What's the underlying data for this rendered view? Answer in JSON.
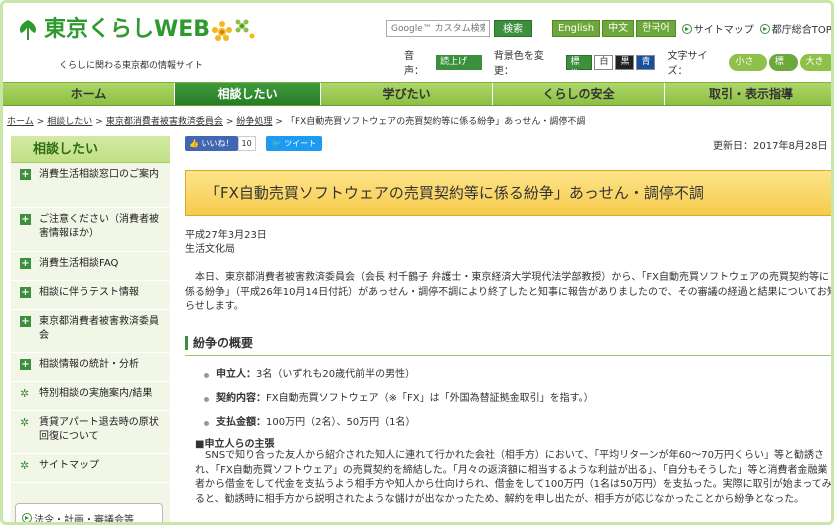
{
  "header": {
    "logo_text": "東京くらしWEB",
    "tagline": "くらしに関わる東京都の情報サイト",
    "search_placeholder": "Google™ カスタム検索",
    "search_button": "検索",
    "languages": [
      "English",
      "中文",
      "한국어"
    ],
    "sitemap_link": "サイトマップ",
    "tokyo_top_link": "都庁総合TOP",
    "voice_label": "音声：",
    "read_aloud": "読上げ",
    "bgcolor_label": "背景色を変更：",
    "bg_options": [
      "標準",
      "白",
      "黒",
      "青"
    ],
    "fontsize_label": "文字サイズ：",
    "fontsize_options": [
      "小さく",
      "標準",
      "大きく"
    ]
  },
  "nav": {
    "items": [
      {
        "label": "ホーム",
        "active": false
      },
      {
        "label": "相談したい",
        "active": true
      },
      {
        "label": "学びたい",
        "active": false
      },
      {
        "label": "くらしの安全",
        "active": false
      },
      {
        "label": "取引・表示指導",
        "active": false
      }
    ]
  },
  "breadcrumb": {
    "items": [
      "ホーム",
      "相談したい",
      "東京都消費者被害救済委員会",
      "紛争処理"
    ],
    "current": "「FX自動売買ソフトウェアの売買契約等に係る紛争」あっせん・調停不調"
  },
  "sidebar": {
    "title": "相談したい",
    "items": [
      {
        "label": "消費生活相談窓口のご案内",
        "icon": "plus-icon"
      },
      {
        "label": "ご注意ください（消費者被害情報ほか）",
        "icon": "plus-icon"
      },
      {
        "label": "消費生活相談FAQ",
        "icon": "plus-icon"
      },
      {
        "label": "相談に伴うテスト情報",
        "icon": "plus-icon"
      },
      {
        "label": "東京都消費者被害救済委員会",
        "icon": "plus-icon"
      },
      {
        "label": "相談情報の統計・分析",
        "icon": "plus-icon"
      },
      {
        "label": "特別相談の実施案内/結果",
        "icon": "star-icon"
      },
      {
        "label": "賃貸アパート退去時の原状回復について",
        "icon": "star-icon"
      },
      {
        "label": "サイトマップ",
        "icon": "star-icon"
      }
    ],
    "bottom_link": "法令・計画・審議会等"
  },
  "share": {
    "like_label": "いいね！",
    "like_count": "10",
    "tweet_label": "ツイート"
  },
  "main": {
    "updated": "更新日：2017年8月28日",
    "title": "「FX自動売買ソフトウェアの売買契約等に係る紛争」あっせん・調停不調",
    "date": "平成27年3月23日",
    "org": "生活文化局",
    "intro": "本日、東京都消費者被害救済委員会（会長 村千鶴子 弁護士・東京経済大学現代法学部教授）から、「FX自動売買ソフトウェアの売買契約等に係る紛争」（平成26年10月14日付託）があっせん・調停不調により終了したと知事に報告がありましたので、その審議の経過と結果についてお知らせします。",
    "section_title": "紛争の概要",
    "bullets": [
      {
        "label": "申立人：",
        "text": "3名（いずれも20歳代前半の男性）"
      },
      {
        "label": "契約内容：",
        "text": "FX自動売買ソフトウェア（※「FX」は「外国為替証拠金取引」を指す。）"
      },
      {
        "label": "支払金額：",
        "text": "100万円（2名）、50万円（1名）"
      }
    ],
    "claim_title": "■申立人らの主張",
    "claim_text": "SNSで知り合った友人から紹介された知人に連れて行かれた会社（相手方）において、「平均リターンが年60〜70万円くらい」等と勧誘され、「FX自動売買ソフトウェア」の売買契約を締結した。「月々の返済額に相当するような利益が出る」、「自分もそうした」等と消費者金融業者から借金をして代金を支払うよう相手方や知人から仕向けられ、借金をして100万円（1名は50万円）を支払った。実際に取引が始まってみると、勧誘時に相手方から説明されたような儲けが出なかったため、解約を申し出たが、相手方が応じなかったことから紛争となった。"
  },
  "colors": {
    "brand_green": "#2e9a2e",
    "nav_green": "#8cc043",
    "title_yellow": "#f6cb4c"
  }
}
